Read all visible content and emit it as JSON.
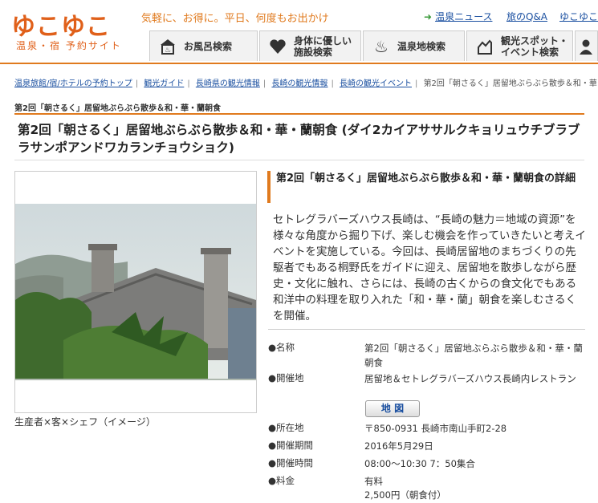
{
  "site": {
    "logo": "ゆこゆこ",
    "logo_sub": "温泉・宿 予約サイト",
    "tagline": "気軽に、お得に。平日、何度もお出かけ"
  },
  "top_links": [
    "温泉ニュース",
    "旅のQ&A",
    "ゆこゆこ"
  ],
  "nav": [
    {
      "label": "お風呂検索",
      "icon": "bath-icon"
    },
    {
      "label": "身体に優しい\n施設検索",
      "icon": "heart-icon"
    },
    {
      "label": "温泉地検索",
      "icon": "onsen-icon"
    },
    {
      "label": "観光スポット・\nイベント検索",
      "icon": "spot-icon"
    },
    {
      "label": "",
      "icon": "user-icon"
    }
  ],
  "breadcrumb": [
    "温泉旅館/宿/ホテルの予約トップ",
    "観光ガイド",
    "長崎県の観光情報",
    "長崎の観光情報",
    "長崎の観光イベント"
  ],
  "breadcrumb_current": "第2回「朝さるく」居留地ぶらぶら散歩＆和・華・",
  "crumb_title": "第2回「朝さるく」居留地ぶらぶら散歩＆和・華・蘭朝食",
  "page_title": "第2回「朝さるく」居留地ぶらぶら散歩＆和・華・蘭朝食 (ダイ2カイアササルクキョリュウチブラブラサンポアンドワカランチョウショク)",
  "photo_caption": "生産者×客×シェフ（イメージ）",
  "detail_heading": "第2回「朝さるく」居留地ぶらぶら散歩＆和・華・蘭朝食の詳細",
  "description": "セトレグラバーズハウス長崎は、“長崎の魅力＝地域の資源”を様々な角度から掘り下げ、楽しむ機会を作っていきたいと考えイベントを実施している。今回は、長崎居留地のまちづくりの先駆者でもある桐野氏をガイドに迎え、居留地を散歩しながら歴史・文化に触れ、さらには、長崎の古くからの食文化でもある和洋中の料理を取り入れた「和・華・蘭」朝食を楽しむさるくを開催。",
  "details": [
    {
      "label": "●名称",
      "value": "第2回「朝さるく」居留地ぶらぶら散歩＆和・華・蘭朝食"
    },
    {
      "label": "●開催地",
      "value": "居留地＆セトレグラバーズハウス長崎内レストラン"
    },
    {
      "label": "●所在地",
      "value": "〒850-0931 長崎市南山手町2-28"
    },
    {
      "label": "●開催期間",
      "value": "2016年5月29日"
    },
    {
      "label": "●開催時間",
      "value": "08:00～10:30 7：50集合"
    },
    {
      "label": "●料金",
      "value": "有料"
    }
  ],
  "price_note": "2,500円（朝食付）",
  "map_button": "地 図",
  "colors": {
    "accent": "#e07a1e",
    "link": "#1a4fa0"
  }
}
